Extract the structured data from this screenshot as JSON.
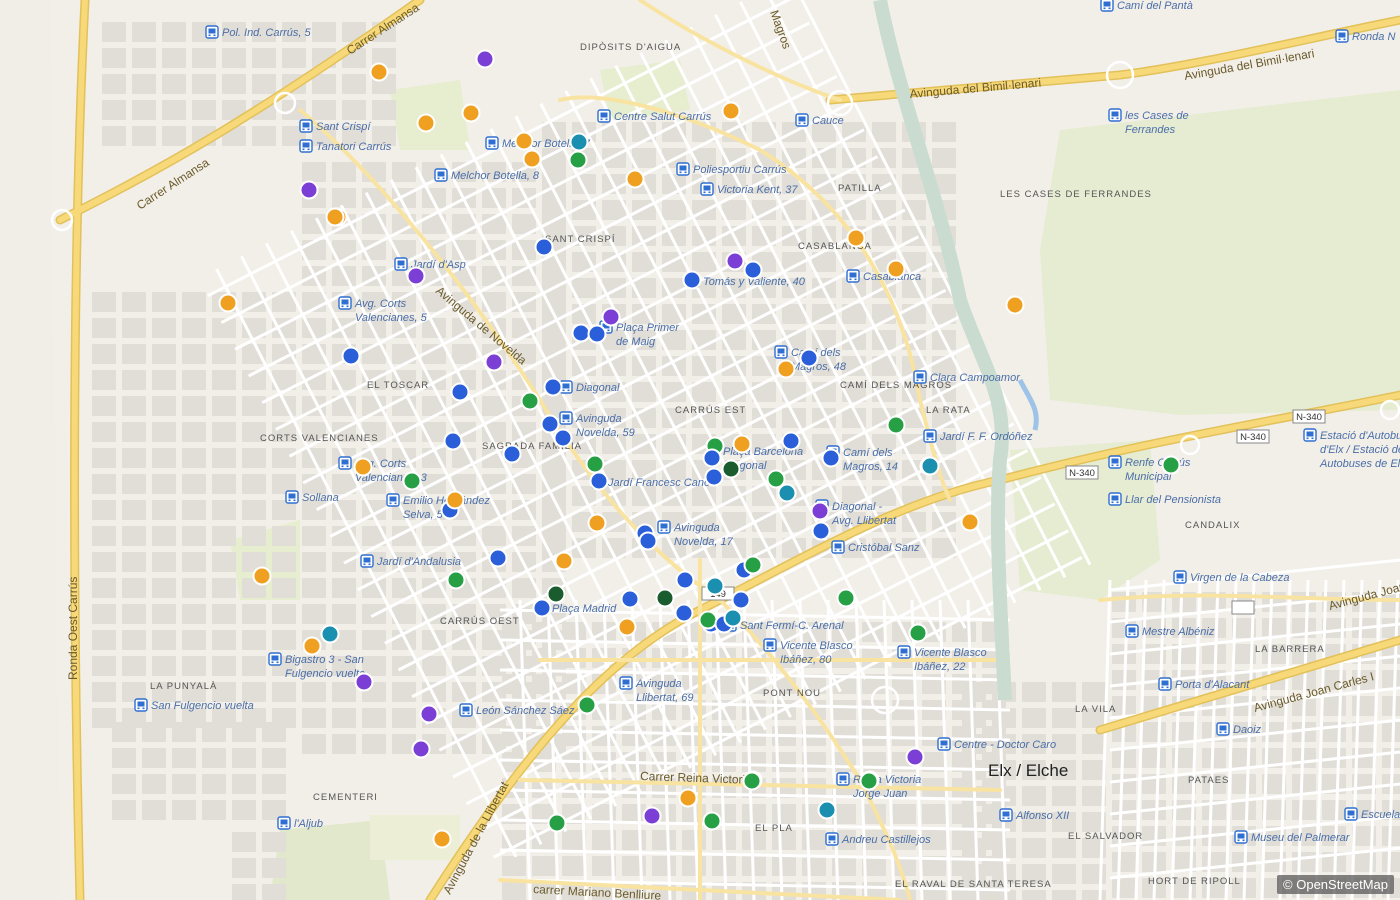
{
  "colors": {
    "background": "#f2efe9",
    "block": "#e3e0da",
    "park": "#e8edd0",
    "primary_road": "#f5d77e",
    "minor_road": "#ffffff",
    "bus_stop": "#2f6fd1",
    "marker_blue": "#2a5fd9",
    "marker_orange": "#f0a020",
    "marker_purple": "#7b3fd6",
    "marker_green": "#27a045",
    "marker_darkgreen": "#1a5c2e",
    "marker_teal": "#1b8fb0"
  },
  "map": {
    "attribution": "© OpenStreetMap",
    "city_label": "Elx / Elche",
    "bus_stops": [
      "Pol. Ind. Carrús, 5",
      "Sant Crispí",
      "Tanatori Carrús",
      "Melchor Botella, 7",
      "Melchor Botella, 8",
      "Centre Salut Carrús",
      "Poliesportiu Carrús",
      "Victoria Kent, 37",
      "Cauce",
      "Camí del Pantà",
      "Ronda N",
      "les Cases de Ferrandes",
      "Jardí d'Asp",
      "Avg. Corts Valencianes, 5",
      "Tomás y Valiente, 40",
      "Plaça Primer de Maig",
      "Casablanca",
      "Camí dels Magros, 48",
      "Clara Campoamor",
      "Diagonal",
      "Avinguda Novelda, 59",
      "Plaça Barcelona Diagonal",
      "Camí dels Magros, 14",
      "Jardí F. F. Ordóñez",
      "Avg. Corts Valencianes, 3",
      "Jardí Francesc Cano",
      "Emilio Hernández Selva, 54",
      "Sollana",
      "Diagonal - Avg. Llibertat",
      "Renfe Carrús Municipal",
      "Estació d'Autobusos d'Elx / Estació de Autobuses de Elche",
      "Llar del Pensionista",
      "Avinguda Novelda, 17",
      "Cristóbal Sanz",
      "Jardí d'Andalusia",
      "Virgen de la Cabeza",
      "Plaça Madrid",
      "Sant Fermí-C. Arenal",
      "Vicente Blasco Ibáñez, 80",
      "Vicente Blasco Ibáñez, 22",
      "Mestre Albéniz",
      "Bigastro 3 - San Fulgencio vuelta",
      "Porta d'Alacant",
      "San Fulgencio vuelta",
      "Avinguda Llibertat, 69",
      "León Sánchez Sáez",
      "Daoiz",
      "Centre - Doctor Caro",
      "Reina Victoria - Jorge Juan",
      "l'Aljub",
      "Alfonso XII",
      "Andreu Castillejos",
      "Museu del Palmerar",
      "Escuelas"
    ],
    "districts": [
      "DIPÒSITS D'AIGUA",
      "SANT CRISPÍ",
      "PATILLA",
      "CASABLANCA",
      "LES CASES DE FERRANDES",
      "EL TOSCAR",
      "CARRÚS EST",
      "CAMÍ DELS MAGROS",
      "LA RATA",
      "CORTS VALENCIANES",
      "SAGRADA FAMÍLIA",
      "CANDALIX",
      "CARRÚS OEST",
      "LA BARRERA",
      "PONT NOU",
      "LA PUNYALÀ",
      "LA VILA",
      "CEMENTERI",
      "PATAES",
      "EL PLA",
      "EL SALVADOR",
      "EL RAVAL DE SANTA TERESA",
      "HORT DE RIPOLL"
    ],
    "streets": [
      "Carrer Almansa",
      "Avinguda del Bimil·lenari",
      "Avinguda de Novelda",
      "Ronda Oest Carrús",
      "Avinguda de la Llibertat",
      "Avinguda Joan Carles I",
      "Carrer Reina Victoria",
      "carrer Mariano Benlliure",
      "Magros"
    ],
    "road_shields": [
      "N-340",
      "N-340",
      "N-340",
      "149"
    ],
    "markers": [
      {
        "color": "purple"
      },
      {
        "color": "orange"
      },
      {
        "color": "orange"
      },
      {
        "color": "orange"
      },
      {
        "color": "orange"
      },
      {
        "color": "teal"
      },
      {
        "color": "orange"
      },
      {
        "color": "green"
      },
      {
        "color": "orange"
      },
      {
        "color": "orange"
      },
      {
        "color": "purple"
      },
      {
        "color": "orange"
      },
      {
        "color": "blue"
      },
      {
        "color": "purple"
      },
      {
        "color": "blue"
      },
      {
        "color": "orange"
      },
      {
        "color": "orange"
      },
      {
        "color": "orange"
      },
      {
        "color": "blue"
      },
      {
        "color": "purple"
      },
      {
        "color": "orange"
      },
      {
        "color": "purple"
      },
      {
        "color": "blue"
      },
      {
        "color": "blue"
      },
      {
        "color": "blue"
      },
      {
        "color": "purple"
      },
      {
        "color": "orange"
      },
      {
        "color": "blue"
      },
      {
        "color": "blue"
      },
      {
        "color": "blue"
      },
      {
        "color": "green"
      },
      {
        "color": "green"
      },
      {
        "color": "blue"
      },
      {
        "color": "blue"
      },
      {
        "color": "blue"
      },
      {
        "color": "blue"
      },
      {
        "color": "orange"
      },
      {
        "color": "blue"
      },
      {
        "color": "blue"
      },
      {
        "color": "green"
      },
      {
        "color": "orange"
      },
      {
        "color": "blue"
      },
      {
        "color": "darkgreen"
      },
      {
        "color": "blue"
      },
      {
        "color": "blue"
      },
      {
        "color": "blue"
      },
      {
        "color": "teal"
      },
      {
        "color": "green"
      },
      {
        "color": "blue"
      },
      {
        "color": "orange"
      },
      {
        "color": "purple"
      },
      {
        "color": "green"
      },
      {
        "color": "green"
      },
      {
        "color": "blue"
      },
      {
        "color": "blue"
      },
      {
        "color": "orange"
      },
      {
        "color": "blue"
      },
      {
        "color": "blue"
      },
      {
        "color": "green"
      },
      {
        "color": "orange"
      },
      {
        "color": "blue"
      },
      {
        "color": "orange"
      },
      {
        "color": "blue"
      },
      {
        "color": "green"
      },
      {
        "color": "teal"
      },
      {
        "color": "green"
      },
      {
        "color": "blue"
      },
      {
        "color": "darkgreen"
      },
      {
        "color": "blue"
      },
      {
        "color": "darkgreen"
      },
      {
        "color": "blue"
      },
      {
        "color": "teal"
      },
      {
        "color": "blue"
      },
      {
        "color": "blue"
      },
      {
        "color": "green"
      },
      {
        "color": "blue"
      },
      {
        "color": "green"
      },
      {
        "color": "teal"
      },
      {
        "color": "orange"
      },
      {
        "color": "orange"
      },
      {
        "color": "green"
      },
      {
        "color": "green"
      },
      {
        "color": "orange"
      },
      {
        "color": "teal"
      },
      {
        "color": "green"
      },
      {
        "color": "orange"
      },
      {
        "color": "purple"
      },
      {
        "color": "purple"
      },
      {
        "color": "purple"
      },
      {
        "color": "purple"
      },
      {
        "color": "green"
      },
      {
        "color": "green"
      },
      {
        "color": "green"
      },
      {
        "color": "orange"
      },
      {
        "color": "purple"
      },
      {
        "color": "green"
      },
      {
        "color": "green"
      },
      {
        "color": "teal"
      },
      {
        "color": "orange"
      }
    ]
  }
}
